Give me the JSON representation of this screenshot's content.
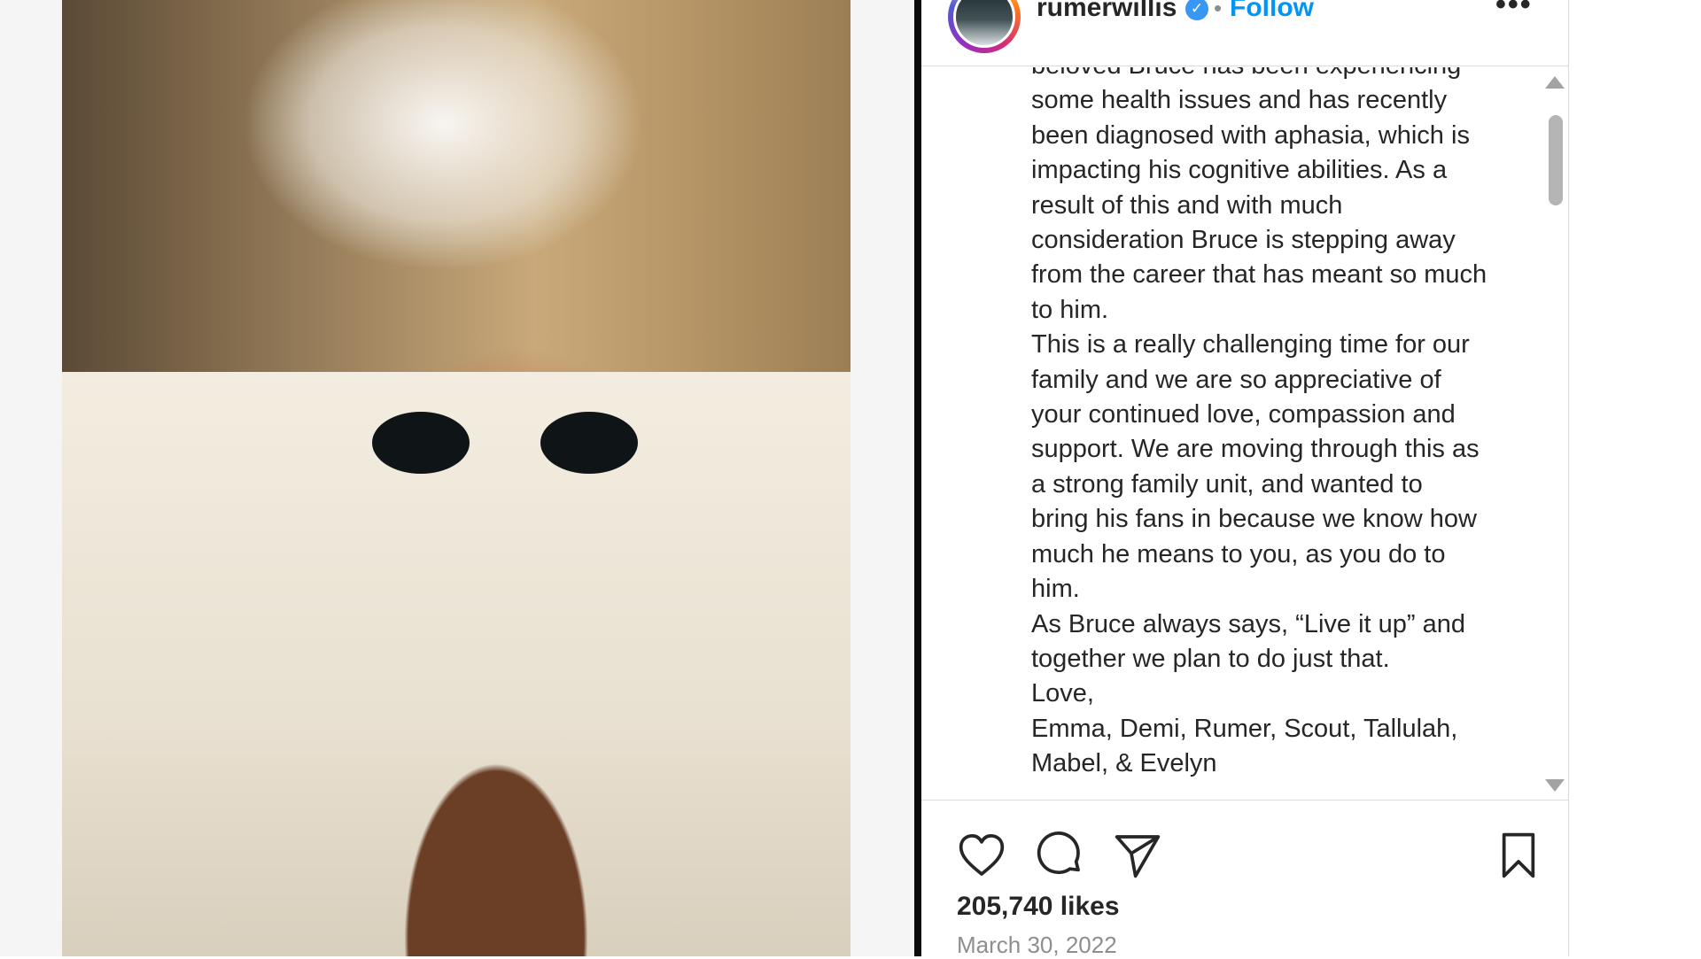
{
  "post": {
    "image_alt": "Man in white bathrobe and towel on head wearing round sunglasses"
  },
  "header": {
    "username": "rumerwillis",
    "verified_icon": "verified-badge-icon",
    "separator": "•",
    "follow_label": "Follow",
    "more_label": "•••"
  },
  "caption": {
    "lines": [
      "beloved Bruce has been experiencing",
      "some health issues and has recently",
      "been diagnosed with aphasia, which is",
      "impacting his cognitive abilities. As a",
      "result of this and with much",
      "consideration Bruce is stepping away",
      "from the career that has meant so much",
      "to him.",
      "This is a really challenging time for our",
      "family and we are so appreciative of",
      "your continued love, compassion and",
      "support. We are moving through this as",
      "a strong family unit, and wanted to",
      "bring his fans in because we know how",
      "much he means to you, as you do to",
      "him.",
      "As Bruce always says, “Live it up” and",
      "together we plan to do just that.",
      "Love,",
      "Emma, Demi, Rumer, Scout, Tallulah,",
      "Mabel, & Evelyn"
    ]
  },
  "actions": {
    "like_icon": "heart-icon",
    "comment_icon": "comment-icon",
    "share_icon": "send-icon",
    "save_icon": "bookmark-icon",
    "likes": "205,740 likes",
    "date": "March 30, 2022"
  }
}
